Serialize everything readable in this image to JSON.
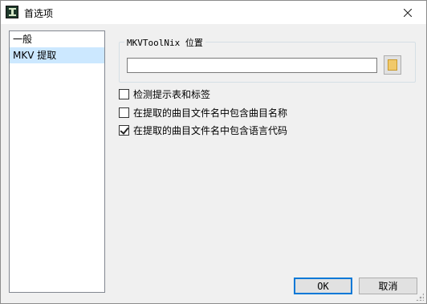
{
  "window": {
    "title": "首选项"
  },
  "sidebar": {
    "items": [
      {
        "label": "一般",
        "selected": false
      },
      {
        "label": "MKV 提取",
        "selected": true
      }
    ]
  },
  "mkvtoolnix": {
    "group_label": "MKVToolNix 位置",
    "path_value": ""
  },
  "options": [
    {
      "label": "检测提示表和标签",
      "checked": false
    },
    {
      "label": "在提取的曲目文件名中包含曲目名称",
      "checked": false
    },
    {
      "label": "在提取的曲目文件名中包含语言代码",
      "checked": true
    }
  ],
  "buttons": {
    "ok_label": "OK",
    "cancel_label": "取消"
  },
  "colors": {
    "selection": "#cce8ff",
    "default_button_border": "#0078d7"
  }
}
